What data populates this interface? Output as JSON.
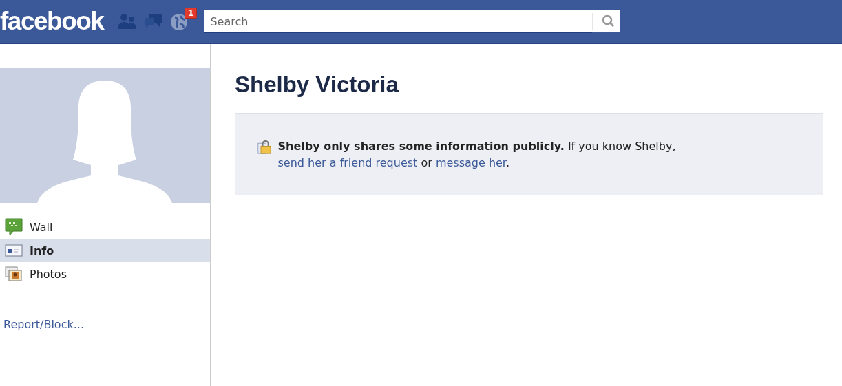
{
  "header": {
    "logo": "facebook",
    "notifications_badge": "1",
    "search": {
      "placeholder": "Search"
    }
  },
  "sidebar": {
    "items": [
      {
        "label": "Wall",
        "kind": "wall",
        "selected": false
      },
      {
        "label": "Info",
        "kind": "info",
        "selected": true
      },
      {
        "label": "Photos",
        "kind": "photos",
        "selected": false
      }
    ],
    "report_link": "Report/Block..."
  },
  "profile": {
    "name": "Shelby Victoria",
    "notice": [
      {
        "kind": "bold",
        "text": "Shelby only shares some information publicly."
      },
      {
        "kind": "text",
        "text": " If you know Shelby, "
      },
      {
        "kind": "link",
        "text": "send her a friend request"
      },
      {
        "kind": "text",
        "text": " or "
      },
      {
        "kind": "link",
        "text": "message her"
      },
      {
        "kind": "text",
        "text": "."
      }
    ]
  }
}
